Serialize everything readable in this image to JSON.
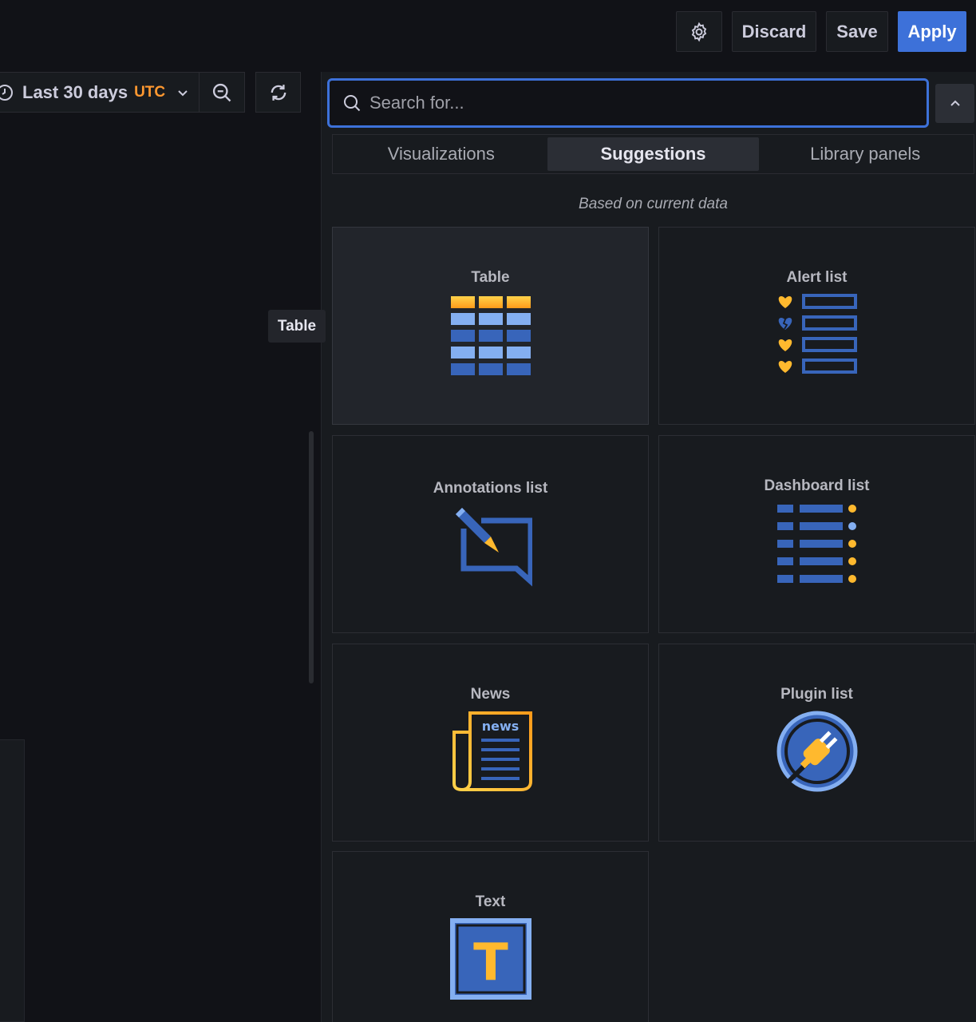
{
  "toolbar": {
    "settings_icon": "gear-icon",
    "discard_label": "Discard",
    "save_label": "Save",
    "apply_label": "Apply"
  },
  "time_picker": {
    "range_label": "Last 30 days",
    "timezone": "UTC",
    "clock_icon": "clock-icon",
    "chevron_icon": "chevron-down-icon",
    "zoom_icon": "zoom-out-icon",
    "refresh_icon": "refresh-icon"
  },
  "tooltip": {
    "text": "Table"
  },
  "search": {
    "placeholder": "Search for...",
    "value": ""
  },
  "tabs": [
    {
      "label": "Visualizations",
      "active": false
    },
    {
      "label": "Suggestions",
      "active": true
    },
    {
      "label": "Library panels",
      "active": false
    }
  ],
  "hint": "Based on current data",
  "cards": [
    {
      "title": "Table",
      "icon": "table-icon"
    },
    {
      "title": "Alert list",
      "icon": "alert-list-icon"
    },
    {
      "title": "Annotations list",
      "icon": "annotations-list-icon"
    },
    {
      "title": "Dashboard list",
      "icon": "dashboard-list-icon"
    },
    {
      "title": "News",
      "icon": "news-icon",
      "icon_text": "news"
    },
    {
      "title": "Plugin list",
      "icon": "plugin-list-icon"
    },
    {
      "title": "Text",
      "icon": "text-icon",
      "icon_text": "T"
    }
  ],
  "colors": {
    "accent_blue": "#3d71d9",
    "utc_orange": "#ff9830",
    "icon_blue": "#3865ba",
    "icon_light_blue": "#84aff1",
    "icon_yellow": "#ffb92e"
  }
}
